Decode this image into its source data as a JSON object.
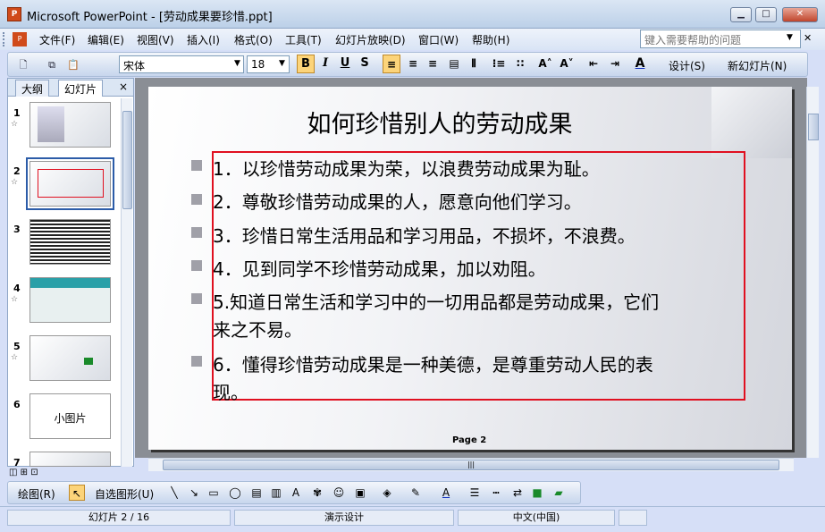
{
  "window": {
    "title": "Microsoft PowerPoint - [劳动成果要珍惜.ppt]",
    "app_icon": "P"
  },
  "menu": {
    "items": [
      "文件(F)",
      "编辑(E)",
      "视图(V)",
      "插入(I)",
      "格式(O)",
      "工具(T)",
      "幻灯片放映(D)",
      "窗口(W)",
      "帮助(H)"
    ],
    "help_placeholder": "键入需要帮助的问题"
  },
  "toolbar": {
    "font_name": "宋体",
    "font_size": "18",
    "bold": "B",
    "italic": "I",
    "underline": "U",
    "shadow": "S",
    "design_label": "设计(S)",
    "new_slide_label": "新幻灯片(N)"
  },
  "left_pane": {
    "tab_outline": "大纲",
    "tab_slides": "幻灯片",
    "close": "×",
    "slide_numbers": [
      "1",
      "2",
      "3",
      "4",
      "5",
      "6",
      "7"
    ],
    "slide6_text": "小图片"
  },
  "slide": {
    "title": "如何珍惜别人的劳动成果",
    "lines": [
      "1．以珍惜劳动成果为荣，以浪费劳动成果为耻。",
      "2．尊敬珍惜劳动成果的人，愿意向他们学习。",
      "3．珍惜日常生活用品和学习用品，不损坏，不浪费。",
      "4．见到同学不珍惜劳动成果，加以劝阻。",
      "5.知道日常生活和学习中的一切用品都是劳动成果，它们",
      "来之不易。",
      "6．懂得珍惜劳动成果是一种美德，是尊重劳动人民的表",
      "现。"
    ],
    "page_label": "Page   2"
  },
  "drawing": {
    "draw_label": "绘图(R)",
    "autoshape_label": "自选图形(U)"
  },
  "status": {
    "slide_pos": "幻灯片 2 / 16",
    "design": "演示设计",
    "language": "中文(中国)"
  },
  "colors": {
    "highlight_border": "#e01020",
    "titlebar": "#bcd0e8"
  }
}
